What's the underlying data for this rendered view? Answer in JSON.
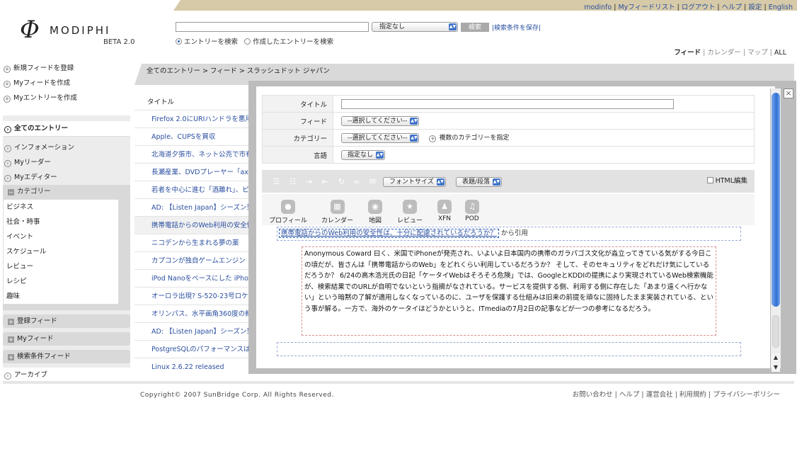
{
  "top_links": [
    "modinfo",
    "Myフィードリスト",
    "ログアウト",
    "ヘルプ",
    "設定",
    "English"
  ],
  "logo": {
    "symbol": "Φ",
    "name": "MODIPHI",
    "beta": "BETA 2.0"
  },
  "search": {
    "input_value": "",
    "scope_selected": "指定なし",
    "button": "検索",
    "save_link": "|検索条件を保存|",
    "radio_entries": "エントリーを検索",
    "radio_created": "作成したエントリーを検索"
  },
  "view_tabs": {
    "feed": "フィード",
    "calendar": "カレンダー",
    "map": "マップ",
    "all": "ALL"
  },
  "sidebar": {
    "actions": [
      "新規フィードを登録",
      "Myフィードを作成",
      "Myエントリーを作成"
    ],
    "nav": [
      "全てのエントリー",
      "インフォメーション",
      "Myリーダー",
      "Myエディター"
    ],
    "category_head": "カテゴリー",
    "categories": [
      "ビジネス",
      "社会・時事",
      "イベント",
      "スケジュール",
      "レビュー",
      "レシピ",
      "趣味"
    ],
    "groups": [
      "登録フィード",
      "Myフィード",
      "検索条件フィード"
    ],
    "archive": "アーカイブ"
  },
  "breadcrumb": "全てのエントリー > フィード > スラッシュドット ジャパン",
  "list_header": "タイトル",
  "entries": [
    "Firefox 2.0にURIハンドラを悪用",
    "Apple、CUPSを買収",
    "北海道夕張市、ネット公売で市有",
    "長瀬産業、DVDプレーヤー「axio",
    "若者を中心に進む「酒離れ」、ビ",
    "AD: 【Listen Japan】シーズン到",
    "携帯電話からのWeb利用の安全性",
    "ニコデンから生まれる夢の薬",
    "カプコンが独自ゲームエンジン「",
    "iPod Nanoをベースにした iPhone",
    "オーロラ出現? S-520-23号ロケ",
    "オリンパス、水平画角360度の新",
    "AD: 【Listen Japan】シーズン到",
    "PostgreSQLのパフォーマンスは",
    "Linux 2.6.22 released"
  ],
  "footer": {
    "copyright": "Copyright© 2007 SunBridge Corp. All Rights Reserved.",
    "links": [
      "お問い合わせ",
      "ヘルプ",
      "運営会社",
      "利用規約",
      "プライバシーポリシー"
    ]
  },
  "modal": {
    "close": "×",
    "form": {
      "title_label": "タイトル",
      "title_value": "",
      "feed_label": "フィード",
      "feed_selected": "--選択してください--",
      "category_label": "カテゴリー",
      "category_selected": "--選択してください--",
      "multi_category": "複数のカテゴリーを指定",
      "language_label": "言語",
      "language_selected": "指定なし"
    },
    "toolbar": {
      "font_size": "フォントサイズ",
      "heading": "表題/段落",
      "html_edit": "HTML編集"
    },
    "insert_icons": [
      "プロフィール",
      "カレンダー",
      "地図",
      "レビュー",
      "XFN",
      "POD"
    ],
    "quote_link": "携帯電話からのWeb利用の安全性は、十分に配慮されているだろうか？",
    "quote_suffix": " から引用",
    "quote_body": "Anonymous Coward 曰く、米国でiPhoneが発売され、いよいよ日本国内の携帯のガラパゴス文化が淼立ってきている気がする今日この頃だが、皆さんは「携帯電話からのWeb」をどれくらい利用しているだろうか？ そして、そのセキュリティをどれだけ気にしているだろうか？ 6/24の高木浩光氏の日記「ケータイWebはそろそろ危険」では、GoogleとKDDIの提携により実現されているWeb検索機能が、検索結果でのURLが自明でないという指摘がなされている。サービスを提供する側、利用する側に存在した「あまり遠くへ行かない」という暗黙の了解が適用しなくなっているのに、ユーザを保護する仕組みは旧来の前提を頑なに固持したまま実装されている、という事が解る。一方で、海外のケータイはどうかというと、ITmediaの7月2日の記事などが一つの参考になるだろう。"
  },
  "colors": {
    "accent": "#2a4fa0",
    "topbar": "#d6caa8",
    "scroll_thumb": "#2f6fd6"
  }
}
